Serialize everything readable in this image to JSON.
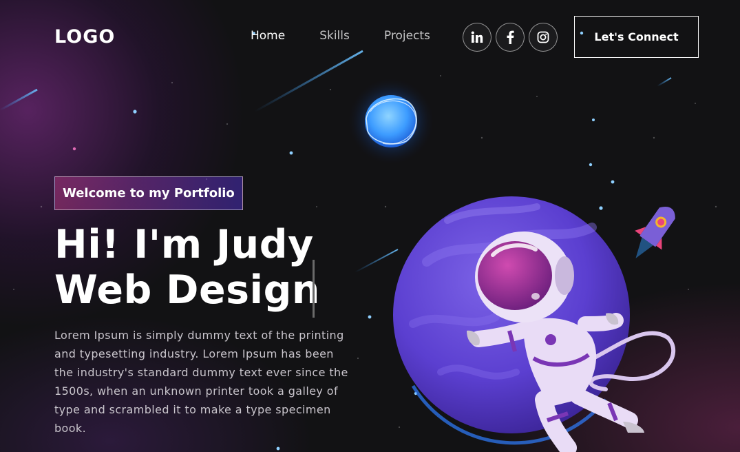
{
  "header": {
    "logo": "LOGO",
    "nav": [
      {
        "label": "Home"
      },
      {
        "label": "Skills"
      },
      {
        "label": "Projects"
      }
    ],
    "social": [
      {
        "icon": "linkedin-icon",
        "glyph": "in"
      },
      {
        "icon": "facebook-icon",
        "glyph": "f"
      },
      {
        "icon": "instagram-icon",
        "glyph": ""
      }
    ],
    "cta_label": "Let's Connect"
  },
  "hero": {
    "tagline": "Welcome to my Portfolio",
    "headline_line1": "Hi! I'm Judy",
    "headline_line2": "Web Design",
    "description": "Lorem Ipsum is simply dummy text of the printing and typesetting industry. Lorem Ipsum has been the industry's standard dummy text ever since the 1500s, when an unknown printer took a galley of type and scrambled it to make a type specimen book."
  },
  "illustration": {
    "items": [
      "astronaut-illustration",
      "purple-planet",
      "blue-planet",
      "rocket-illustration",
      "shooting-stars"
    ]
  },
  "colors": {
    "background": "#121214",
    "tagline_gradient_start": "#aa367c",
    "tagline_gradient_end": "#4a2fbd",
    "planet": "#6a4fd8",
    "blue_planet": "#4aa3ff",
    "text_muted": "#c9c5cc"
  }
}
